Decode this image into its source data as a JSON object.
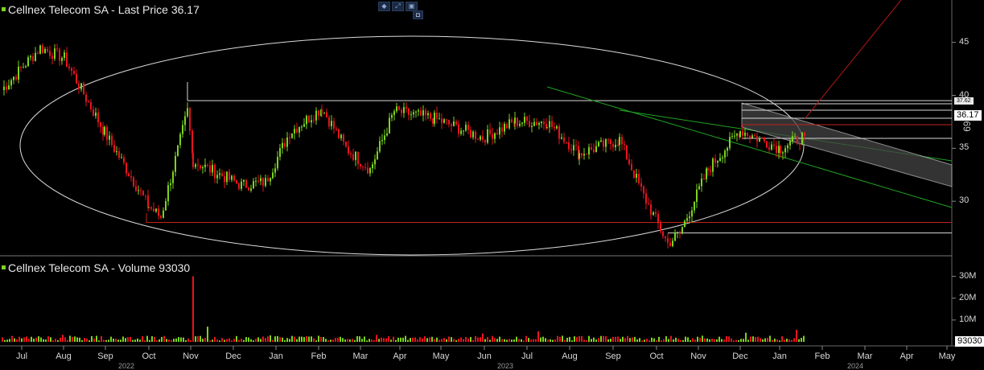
{
  "price_legend": "Cellnex Telecom SA - Last Price 36.17",
  "volume_legend": "Cellnex Telecom SA - Volume 93030",
  "toolbar": {
    "b1": "◆",
    "b2": "⤢",
    "b3": "▣",
    "b4": "◘"
  },
  "vertical_label": "69",
  "hl_badge": "37.62",
  "chart_data": [
    {
      "type": "line",
      "title": "Cellnex Telecom SA - Last Price 36.17",
      "last_price": 36.17,
      "last_price_label": "36.17",
      "y_ticks": [
        45,
        40,
        35,
        30
      ],
      "ylim": [
        25,
        49
      ],
      "x": [
        "Jul",
        "Aug",
        "Sep",
        "Oct",
        "Nov",
        "Dec",
        "Jan",
        "Feb",
        "Mar",
        "Apr",
        "May",
        "Jun",
        "Jul",
        "Aug",
        "Sep",
        "Oct",
        "Nov",
        "Dec",
        "Jan"
      ],
      "series": [
        {
          "values": [
            43.5,
            43.0,
            36.5,
            29.5,
            33.5,
            32.0,
            31.8,
            38.0,
            35.0,
            37.8,
            37.8,
            36.0,
            37.0,
            34.5,
            35.5,
            26.0,
            32.5,
            36.0,
            35.5
          ]
        }
      ],
      "annotations": {
        "upper_band": 39.5,
        "lower_band": 28.0,
        "range_low": 27.0,
        "range_high": 37.5
      }
    },
    {
      "type": "bar",
      "title": "Cellnex Telecom SA - Volume 93030",
      "last_volume": 93030,
      "last_volume_label": "93030",
      "y_ticks": [
        "30M",
        "20M",
        "10M"
      ],
      "ylim": [
        0,
        35
      ],
      "spike": {
        "month": "Nov",
        "value_millions": 30
      },
      "typical_millions": 2
    }
  ],
  "x_axis": {
    "months": [
      "Jul",
      "Aug",
      "Sep",
      "Oct",
      "Nov",
      "Dec",
      "Jan",
      "Feb",
      "Mar",
      "Apr",
      "May",
      "Jun",
      "Jul",
      "Aug",
      "Sep",
      "Oct",
      "Nov",
      "Dec",
      "Jan",
      "Feb",
      "Mar",
      "Apr",
      "May"
    ],
    "years": [
      "2022",
      "2023",
      "2024"
    ]
  },
  "colors": {
    "up": "#7cd321",
    "down": "#e8141e",
    "line": "#e0e0e0",
    "channel": "#1fa31f",
    "bg": "#000000"
  }
}
